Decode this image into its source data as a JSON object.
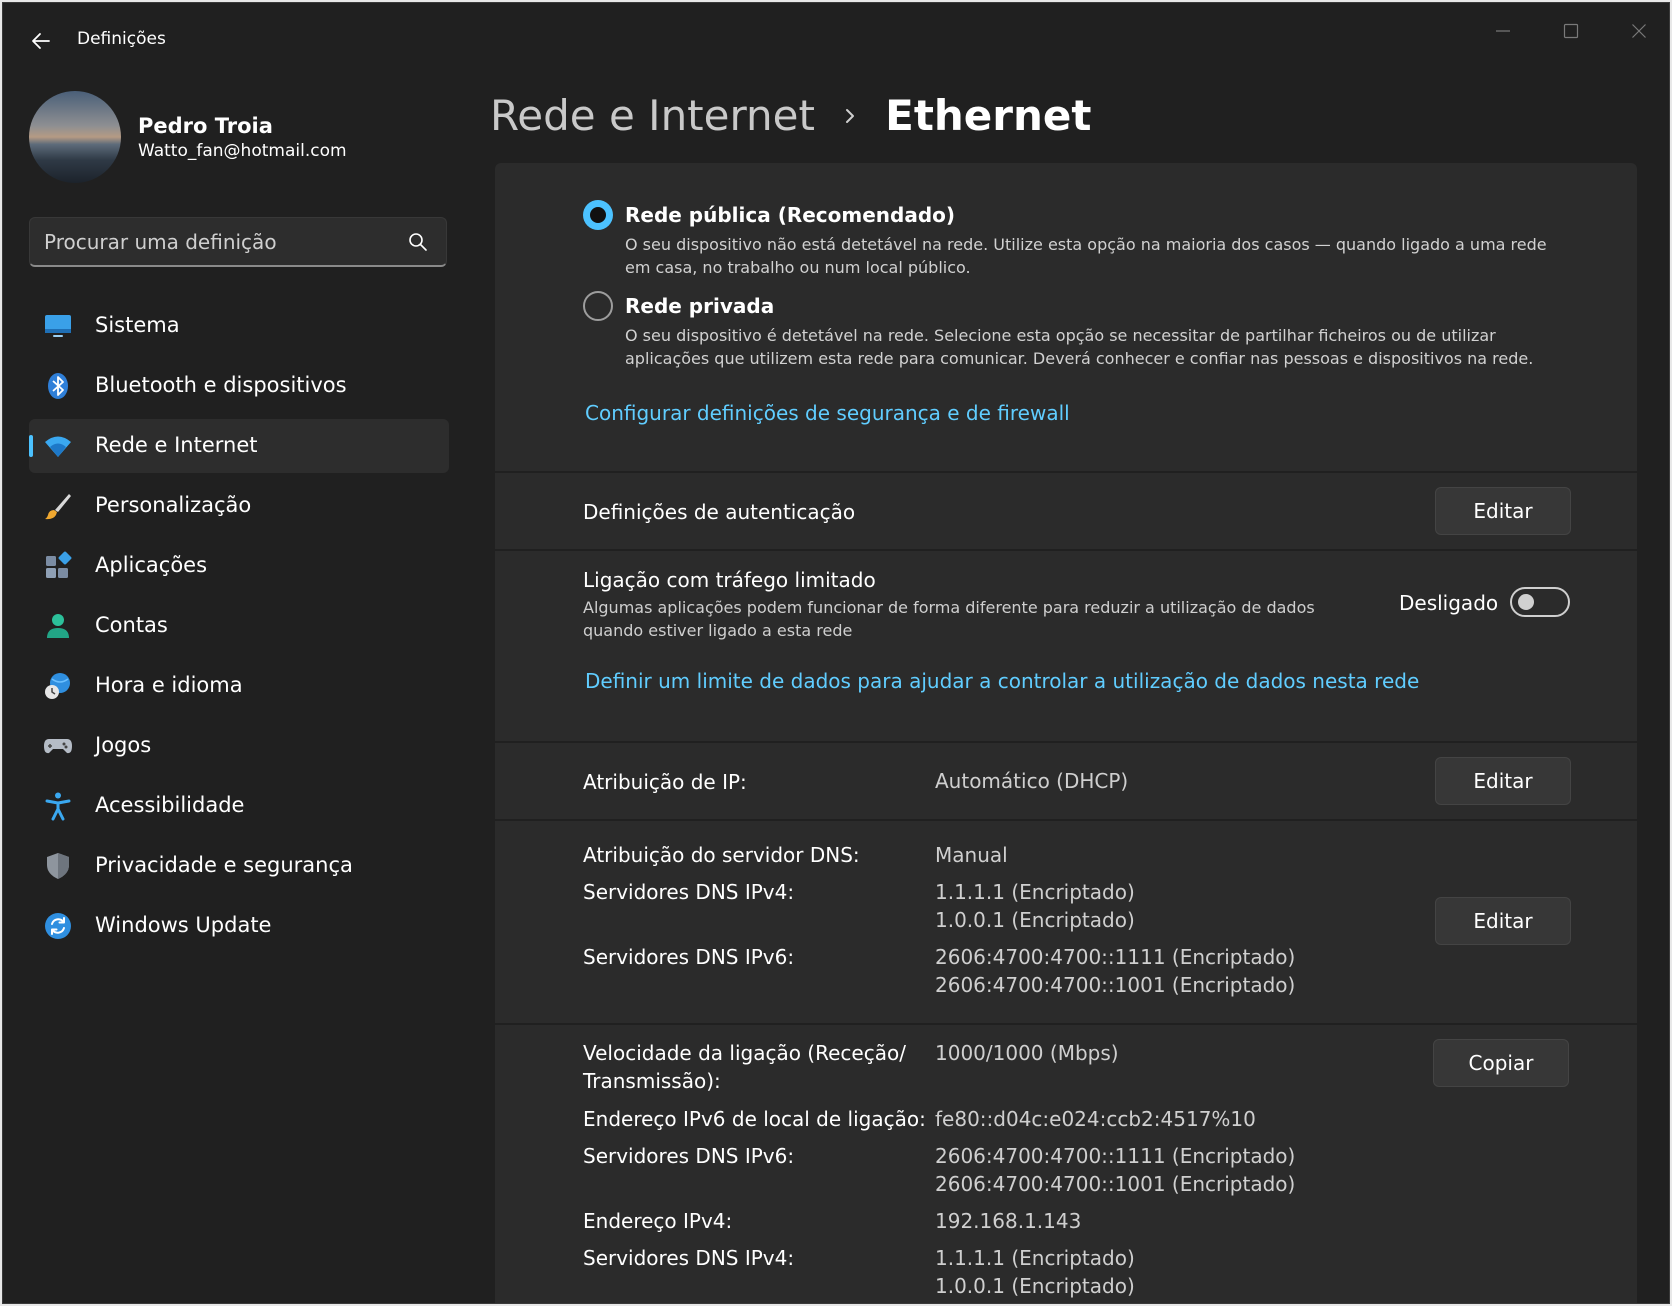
{
  "window": {
    "title": "Definições"
  },
  "profile": {
    "name": "Pedro Troia",
    "email": "Watto_fan@hotmail.com"
  },
  "search": {
    "placeholder": "Procurar uma definição"
  },
  "sidebar": {
    "items": [
      {
        "label": "Sistema",
        "icon": "monitor-icon"
      },
      {
        "label": "Bluetooth e dispositivos",
        "icon": "bluetooth-icon"
      },
      {
        "label": "Rede e Internet",
        "icon": "wifi-icon",
        "active": true
      },
      {
        "label": "Personalização",
        "icon": "paintbrush-icon"
      },
      {
        "label": "Aplicações",
        "icon": "apps-icon"
      },
      {
        "label": "Contas",
        "icon": "person-icon"
      },
      {
        "label": "Hora e idioma",
        "icon": "globe-clock-icon"
      },
      {
        "label": "Jogos",
        "icon": "gamepad-icon"
      },
      {
        "label": "Acessibilidade",
        "icon": "accessibility-icon"
      },
      {
        "label": "Privacidade e segurança",
        "icon": "shield-icon"
      },
      {
        "label": "Windows Update",
        "icon": "sync-icon"
      }
    ]
  },
  "breadcrumb": {
    "parent": "Rede e Internet",
    "current": "Ethernet"
  },
  "network_profile": {
    "public": {
      "title": "Rede pública (Recomendado)",
      "desc": "O seu dispositivo não está detetável na rede. Utilize esta opção na maioria dos casos — quando ligado a uma rede em casa, no trabalho ou num local público.",
      "selected": true
    },
    "private": {
      "title": "Rede privada",
      "desc": "O seu dispositivo é detetável na rede. Selecione esta opção se necessitar de partilhar ficheiros ou de utilizar aplicações que utilizem esta rede para comunicar. Deverá conhecer e confiar nas pessoas e dispositivos na rede.",
      "selected": false
    },
    "firewall_link": "Configurar definições de segurança e de firewall"
  },
  "auth": {
    "label": "Definições de autenticação",
    "button": "Editar"
  },
  "metered": {
    "label": "Ligação com tráfego limitado",
    "desc": "Algumas aplicações podem funcionar de forma diferente para reduzir a utilização de dados quando estiver ligado a esta rede",
    "state_label": "Desligado",
    "enabled": false,
    "data_limit_link": "Definir um limite de dados para ajudar a controlar a utilização de dados nesta rede"
  },
  "ip": {
    "label": "Atribuição de IP:",
    "value": "Automático (DHCP)",
    "button": "Editar"
  },
  "dns": {
    "assign_label": "Atribuição do servidor DNS:",
    "assign_value": "Manual",
    "ipv4_label": "Servidores DNS IPv4:",
    "ipv4_values": [
      "1.1.1.1 (Encriptado)",
      "1.0.0.1 (Encriptado)"
    ],
    "ipv6_label": "Servidores DNS IPv6:",
    "ipv6_values": [
      "2606:4700:4700::1111 (Encriptado)",
      "2606:4700:4700::1001 (Encriptado)"
    ],
    "button": "Editar"
  },
  "properties": {
    "speed_label_1": "Velocidade da ligação (Receção/",
    "speed_label_2": "Transmissão):",
    "speed_value": "1000/1000 (Mbps)",
    "link_local_label": "Endereço IPv6 de local de ligação:",
    "link_local_value": "fe80::d04c:e024:ccb2:4517%10",
    "dns6_label": "Servidores DNS IPv6:",
    "dns6_values": [
      "2606:4700:4700::1111 (Encriptado)",
      "2606:4700:4700::1001 (Encriptado)"
    ],
    "ipv4_label": "Endereço IPv4:",
    "ipv4_value": "192.168.1.143",
    "dns4_label": "Servidores DNS IPv4:",
    "dns4_values": [
      "1.1.1.1 (Encriptado)",
      "1.0.0.1 (Encriptado)"
    ],
    "button": "Copiar"
  },
  "colors": {
    "accent": "#4cc2ff",
    "link": "#60cdff",
    "background": "#202020",
    "card": "#2b2b2b"
  }
}
